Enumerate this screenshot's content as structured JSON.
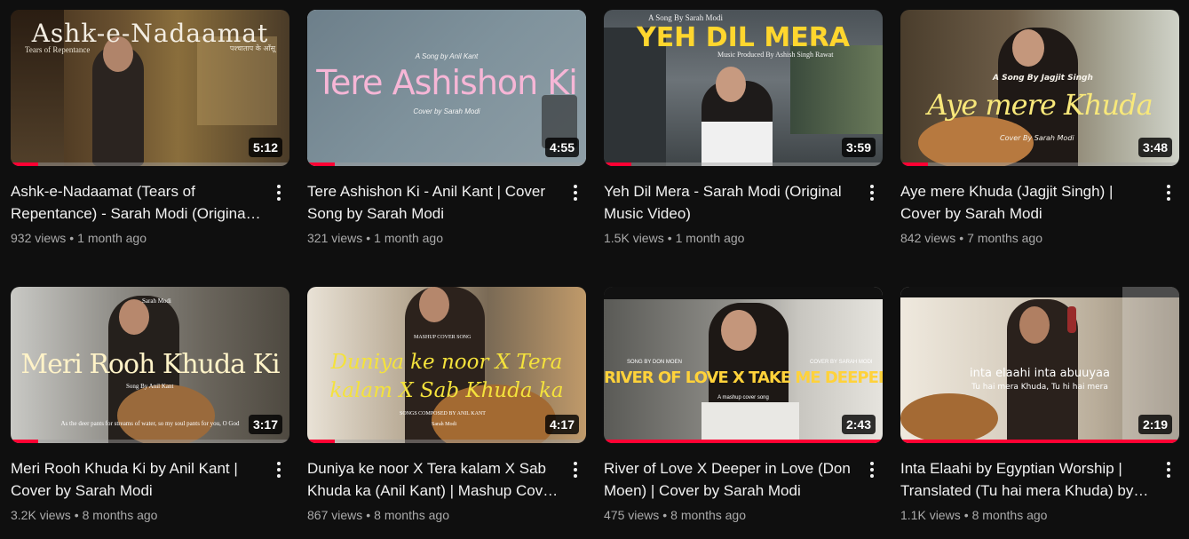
{
  "videos": [
    {
      "title": "Ashk-e-Nadaamat (Tears of Repentance) - Sarah Modi (Original Music Video)",
      "views": "932 views",
      "age": "1 month ago",
      "duration": "5:12",
      "progress": 0.1,
      "thumb": {
        "main": "Ashk-e-Nadaamat",
        "sub1": "Tears of Repentance",
        "sub2": "पश्चाताप के आँसू"
      }
    },
    {
      "title": "Tere Ashishon Ki - Anil Kant | Cover Song by Sarah Modi",
      "views": "321 views",
      "age": "1 month ago",
      "duration": "4:55",
      "progress": 0.1,
      "thumb": {
        "top": "A Song by Anil Kant",
        "main": "Tere Ashishon Ki",
        "bottom": "Cover by Sarah Modi"
      }
    },
    {
      "title": "Yeh Dil Mera - Sarah Modi (Original Music Video)",
      "views": "1.5K views",
      "age": "1 month ago",
      "duration": "3:59",
      "progress": 0.1,
      "thumb": {
        "top": "A Song By Sarah Modi",
        "main": "YEH DIL MERA",
        "bottom": "Music Produced By Ashish Singh Rawat"
      }
    },
    {
      "title": "Aye mere Khuda (Jagjit Singh) | Cover by Sarah Modi",
      "views": "842 views",
      "age": "7 months ago",
      "duration": "3:48",
      "progress": 0.1,
      "thumb": {
        "top": "A Song By Jagjit Singh",
        "main": "Aye mere Khuda",
        "bottom": "Cover By Sarah Modi"
      }
    },
    {
      "title": "Meri Rooh Khuda Ki by Anil Kant | Cover by Sarah Modi",
      "views": "3.2K views",
      "age": "8 months ago",
      "duration": "3:17",
      "progress": 0.1,
      "thumb": {
        "top": "Sarah Modi",
        "main": "Meri Rooh Khuda Ki",
        "sub1": "Song By Anil Kant",
        "bottom": "As the deer pants for streams of water, so my soul pants for you, O God"
      }
    },
    {
      "title": "Duniya ke noor X Tera kalam X Sab Khuda ka (Anil Kant) | Mashup Cover Song",
      "views": "867 views",
      "age": "8 months ago",
      "duration": "4:17",
      "progress": 0.1,
      "thumb": {
        "top": "MASHUP COVER SONG",
        "main": "Duniya ke noor X Tera",
        "main2": "kalam X Sab Khuda ka",
        "bottom": "SONGS COMPOSED BY ANIL KANT",
        "sub2": "Sarah Modi"
      }
    },
    {
      "title": "River of Love X Deeper in Love (Don Moen) | Cover by Sarah Modi",
      "views": "475 views",
      "age": "8 months ago",
      "duration": "2:43",
      "progress": 1.0,
      "thumb": {
        "top": "SONG BY DON MOEN",
        "top2": "COVER BY SARAH MODI",
        "main": "RIVER OF LOVE X TAKE ME DEEPER",
        "bottom": "A mashup cover song"
      }
    },
    {
      "title": "Inta Elaahi by Egyptian Worship | Translated (Tu hai mera Khuda) by Sarah Modi",
      "views": "1.1K views",
      "age": "8 months ago",
      "duration": "2:19",
      "progress": 1.0,
      "thumb": {
        "main": "inta elaahi inta abuuyaa",
        "bottom": "Tu hai mera Khuda, Tu hi hai mera"
      }
    }
  ],
  "colors": {
    "background": "#0f0f0f",
    "progress": "#ff0033",
    "meta": "#aaaaaa"
  }
}
